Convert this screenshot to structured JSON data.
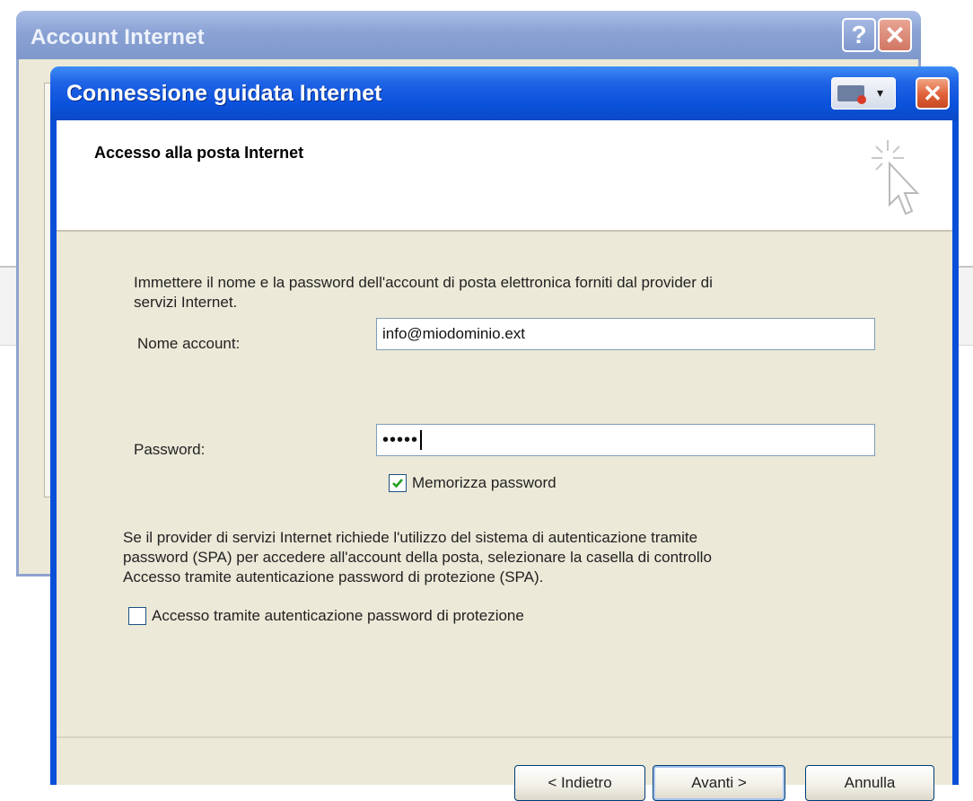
{
  "background_window": {
    "title": "Account Internet",
    "help_label": "?",
    "close_label": "✕"
  },
  "wizard": {
    "title": "Connessione guidata Internet",
    "close_label": "✕",
    "menu_arrow": "▾",
    "page_title": "Accesso alla posta Internet",
    "intro_line1": "Immettere il nome e la password dell'account di posta elettronica forniti dal provider di",
    "intro_line2": "servizi Internet.",
    "account_label": "Nome account:",
    "account_value": "info@miodominio.ext",
    "password_label": "Password:",
    "password_value": "•••••",
    "remember_label": "Memorizza password",
    "remember_checked": true,
    "spa_line1": "Se il provider di servizi Internet richiede l'utilizzo del sistema di autenticazione tramite",
    "spa_line2": "password (SPA) per accedere all'account della posta, selezionare la casella di controllo",
    "spa_line3": "Accesso tramite autenticazione password di protezione (SPA).",
    "spa_checkbox_label": "Accesso tramite autenticazione password di protezione",
    "spa_checked": false,
    "back_button": "< Indietro",
    "next_button": "Avanti >",
    "cancel_button": "Annulla"
  },
  "colors": {
    "titlebar_blue": "#0a52dc",
    "dialog_face": "#ece9d8",
    "close_red": "#e06038"
  },
  "icons": {
    "wizard_graphic": "cursor-sparkle-icon",
    "window_menu": "window-menu-icon",
    "checkmark": "checkmark-icon"
  }
}
